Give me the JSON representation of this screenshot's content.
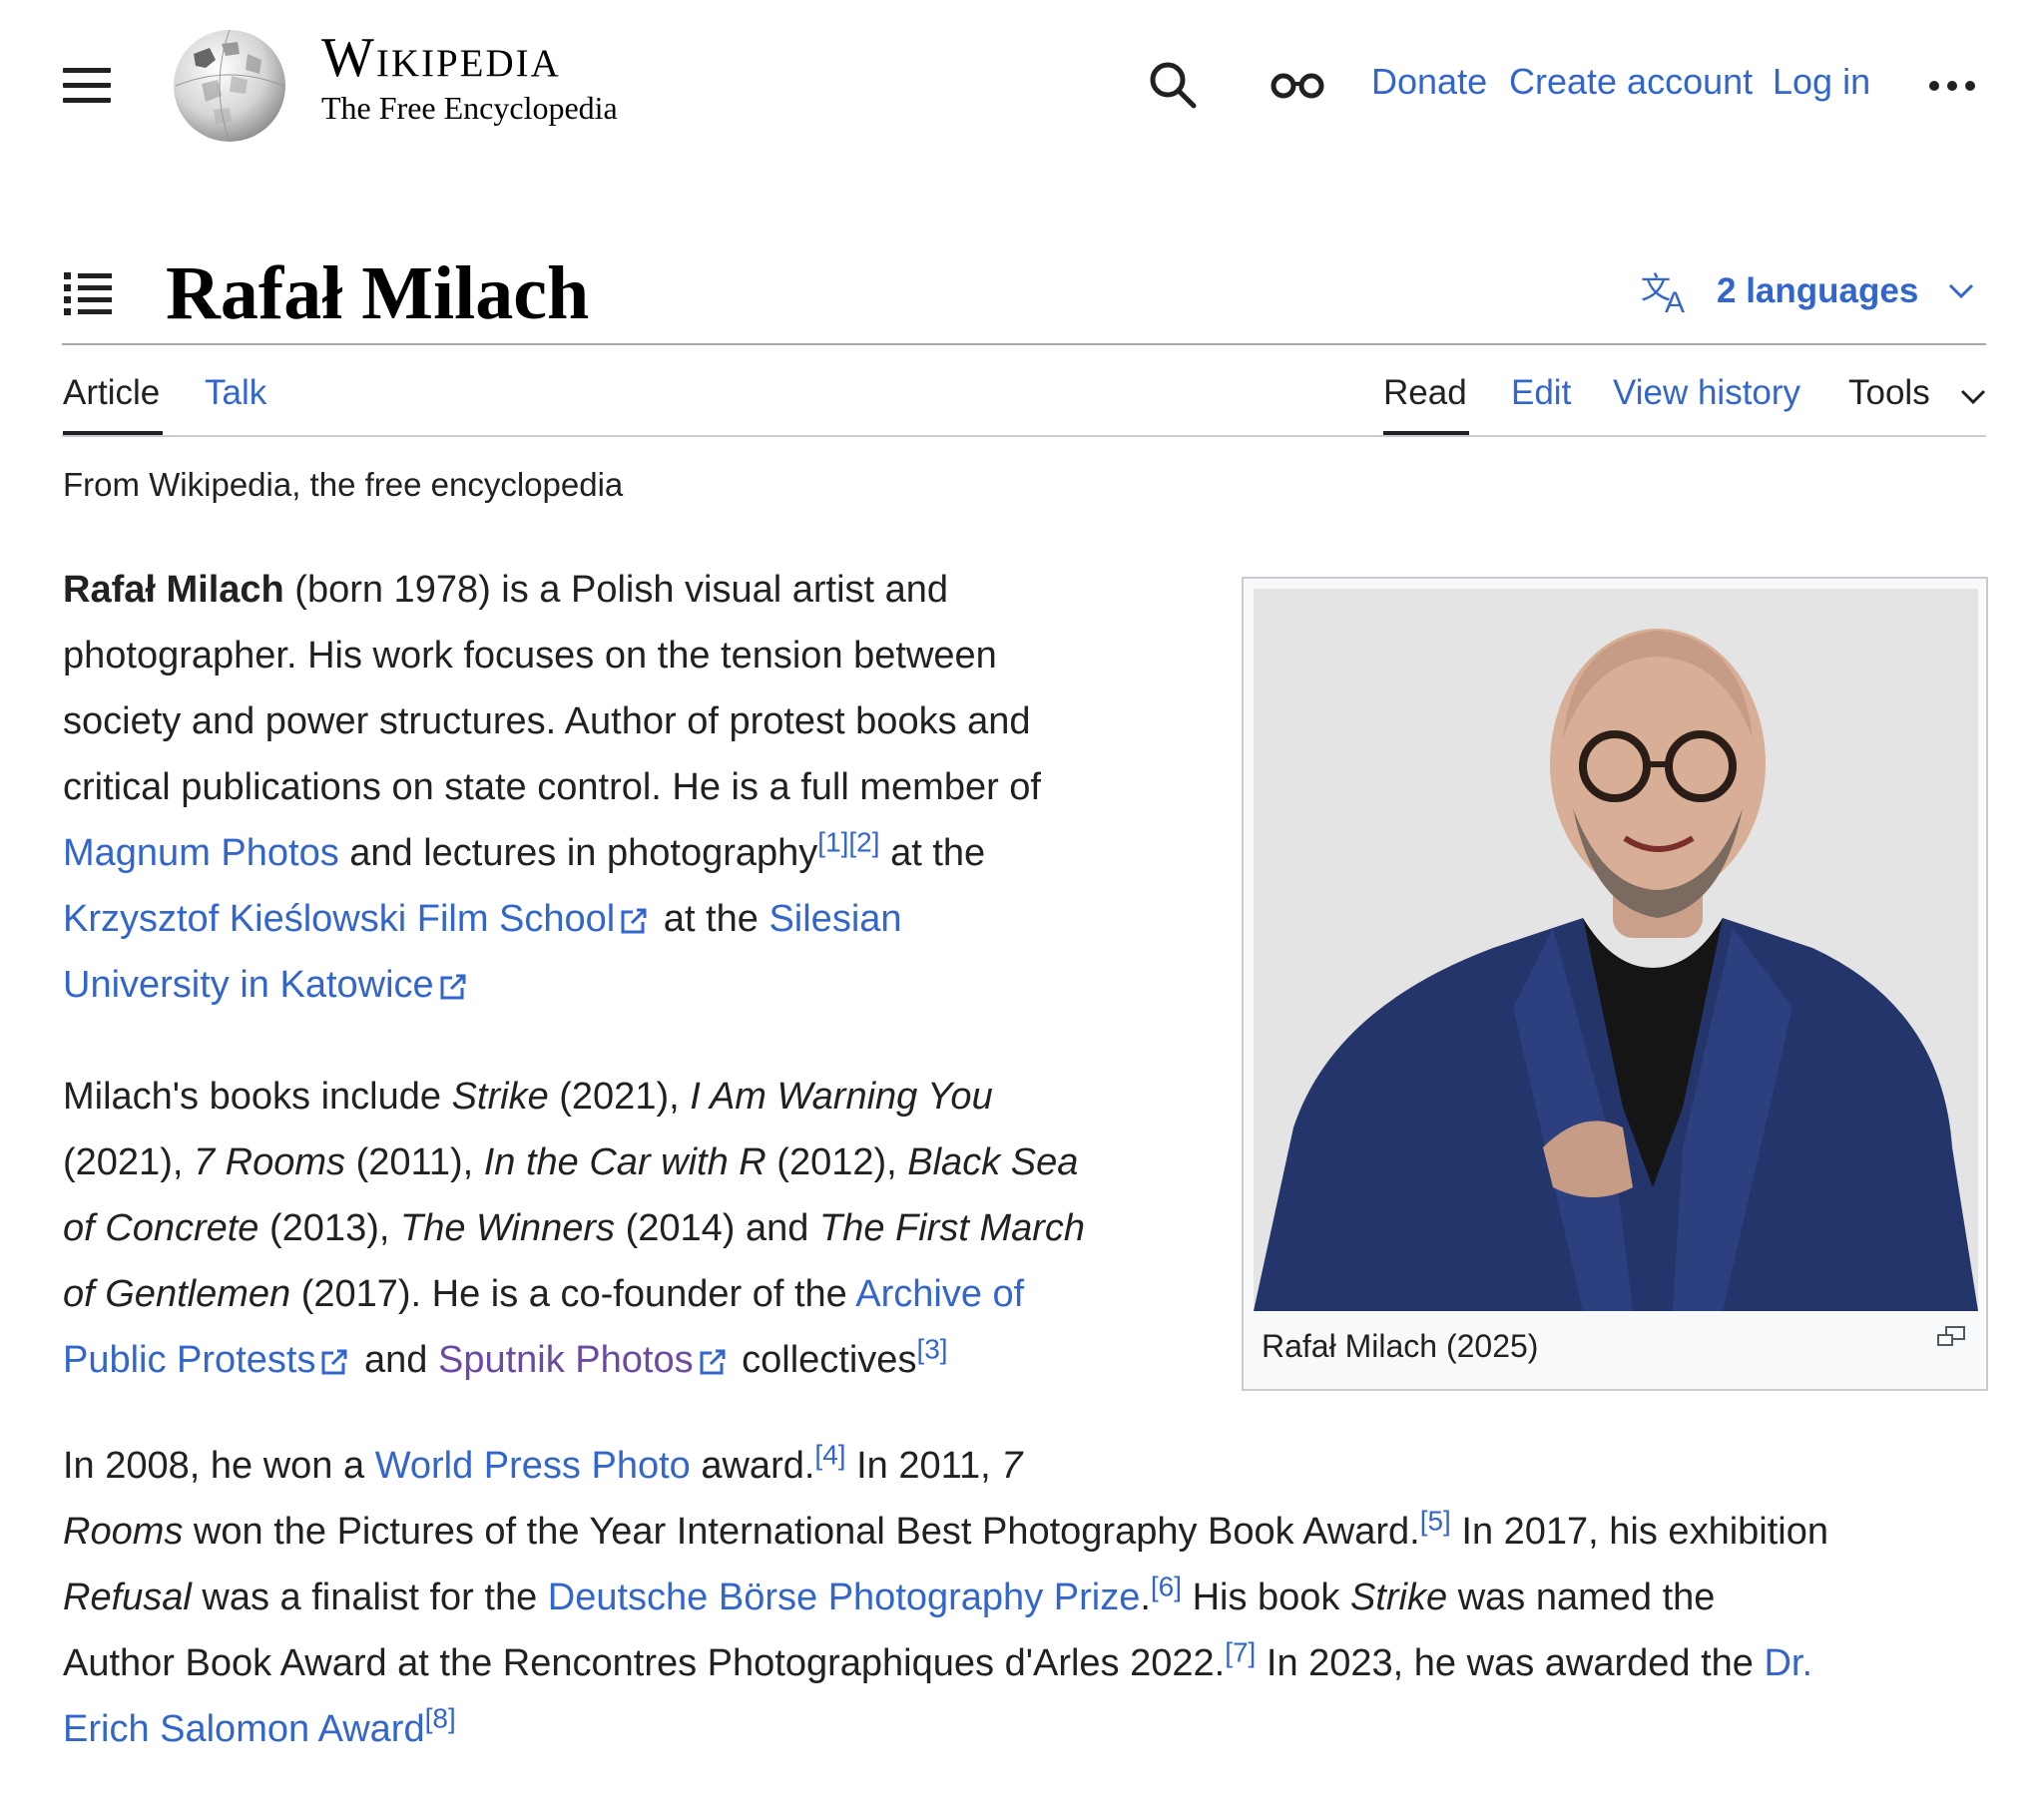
{
  "header": {
    "wordmark_title": "Wikipedia",
    "wordmark_tagline": "The Free Encyclopedia",
    "links": {
      "donate": "Donate",
      "create_account": "Create account",
      "log_in": "Log in"
    }
  },
  "article": {
    "title": "Rafał Milach",
    "languages_label": "2 languages",
    "tabs": {
      "article": "Article",
      "talk": "Talk",
      "read": "Read",
      "edit": "Edit",
      "view_history": "View history",
      "tools": "Tools"
    },
    "tagline": "From Wikipedia, the free encyclopedia"
  },
  "infobox": {
    "caption": "Rafał Milach (2025)"
  },
  "paragraphs": {
    "p1": {
      "l1_bold": "Rafał Milach",
      "l1_rest": " (born 1978) is a Polish visual artist and",
      "l2": "photographer. His work focuses on the tension between",
      "l3": "society and power structures. Author of protest books and",
      "l4": "critical publications on state control. He is a full member of",
      "l5_link": "Magnum Photos",
      "l5_text": " and lectures in photography",
      "l5_ref1": "[1]",
      "l5_ref2": "[2]",
      "l5_tail": " at the",
      "l6_link": "Krzysztof Kieślowski Film School",
      "l6_text": " at the ",
      "l6_link2": "Silesian",
      "l7_link": "University in Katowice"
    },
    "p2": {
      "a": "Milach's books include ",
      "strike": "Strike",
      "b": " (2021), ",
      "warning": "I Am Warning You",
      "c": "(2021), ",
      "rooms": "7 Rooms",
      "d": " (2011), ",
      "car": "In the Car with R",
      "e": " (2012), ",
      "blacksea1": "Black Sea",
      "blacksea2": "of Concrete",
      "f": " (2013), ",
      "winners": "The Winners",
      "g": " (2014) and ",
      "march1": "The First March",
      "march2": "of Gentlemen",
      "h": " (2017). He is a co-founder of the ",
      "archive1": "Archive of",
      "archive2": "Public Protests",
      "i": " and ",
      "sputnik": "Sputnik Photos",
      "j": " collectives",
      "ref3": "[3]"
    },
    "p3": {
      "a": "In 2008, he won a ",
      "wpp": "World Press Photo",
      "b": " award.",
      "ref4": "[4]",
      "c": " In 2011, ",
      "rooms1": "7",
      "rooms2": "Rooms",
      "d": " won the Pictures of the Year International Best Photography Book Award.",
      "ref5": "[5]",
      "e": " In 2017, his exhibition",
      "refusal": "Refusal",
      "f": " was a finalist for the ",
      "dbpp": "Deutsche Börse Photography Prize",
      "g": ".",
      "ref6": "[6]",
      "h": " His book ",
      "strike": "Strike",
      "i": " was named the",
      "j": "Author Book Award at the Rencontres Photographiques d'Arles 2022.",
      "ref7": "[7]",
      "k": " In 2023, he was awarded the ",
      "dr1": "Dr.",
      "dr2": "Erich Salomon Award",
      "ref8": "[8]"
    }
  }
}
